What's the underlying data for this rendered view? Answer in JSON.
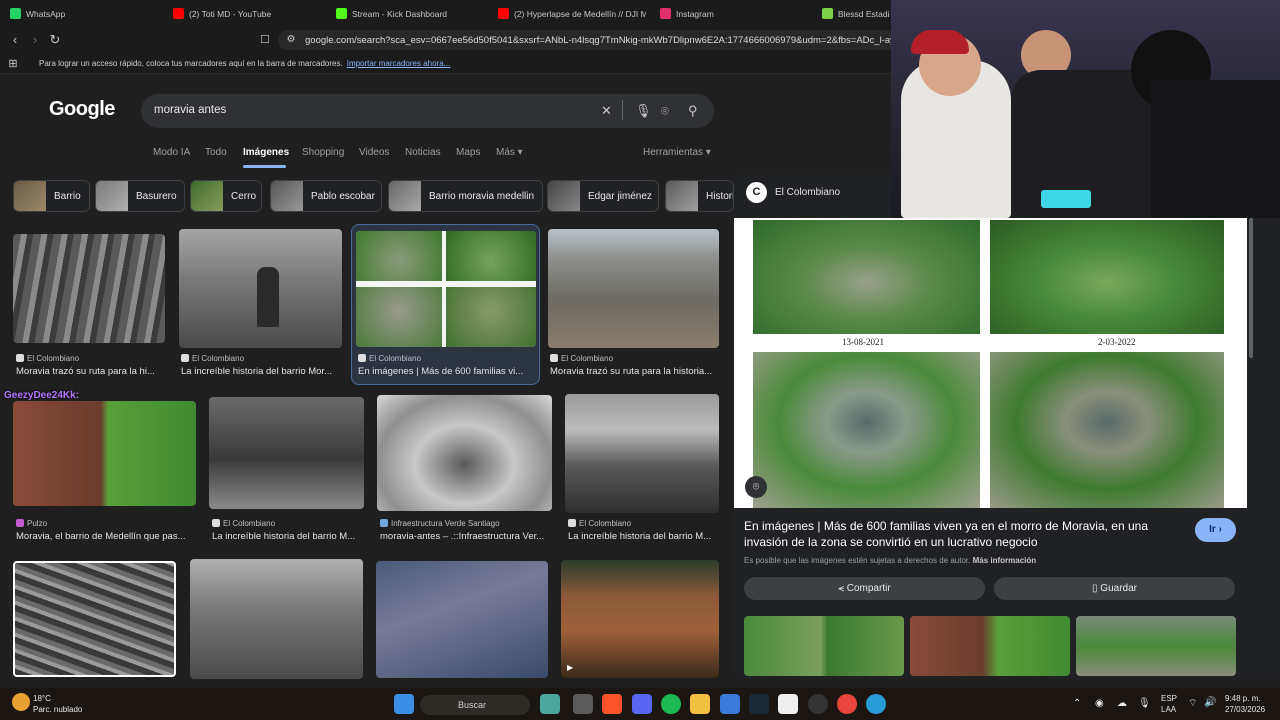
{
  "browser": {
    "tabs": [
      {
        "label": "WhatsApp",
        "color": "#25d366"
      },
      {
        "label": "(2) Toti MD - YouTube",
        "color": "#ff0000"
      },
      {
        "label": "Stream - Kick Dashboard",
        "color": "#53fc18"
      },
      {
        "label": "(2) Hyperlapse de Medellín // DJI M",
        "color": "#ff0000"
      },
      {
        "label": "Instagram",
        "color": "#e1306c"
      },
      {
        "label": "Blessd Estadio",
        "color": "#7cd34a"
      }
    ],
    "url": "google.com/search?sca_esv=0667ee56d50f5041&sxsrf=ANbL-n4lsqg7TmNkig-mkWb7Dlipnw6E2A:1774666006979&udm=2&fbs=ADc_l-ay2rO",
    "bookmarks_text": "Para lograr un acceso rápido, coloca tus marcadores aquí en la barra de marcadores.",
    "bookmarks_link": "Importar marcadores ahora..."
  },
  "google": {
    "logo": "Google",
    "query": "moravia antes",
    "tabs": [
      "Modo IA",
      "Todo",
      "Imágenes",
      "Shopping",
      "Videos",
      "Noticias",
      "Maps",
      "Más ▾"
    ],
    "tools": "Herramientas ▾"
  },
  "chips": [
    "Barrio",
    "Basurero",
    "Cerro",
    "Pablo escobar",
    "Barrio moravia medellin",
    "Edgar jiménez",
    "Histori"
  ],
  "results": [
    {
      "source": "El Colombiano",
      "caption": "Moravia trazó su ruta para la hi..."
    },
    {
      "source": "El Colombiano",
      "caption": "La increíble historia del barrio Mor..."
    },
    {
      "source": "El Colombiano",
      "caption": "En imágenes | Más de 600 familias vi..."
    },
    {
      "source": "El Colombiano",
      "caption": "Moravia trazó su ruta para la historia..."
    },
    {
      "source": "Pulzo",
      "caption": "Moravia, el barrio de Medellín que pas..."
    },
    {
      "source": "El Colombiano",
      "caption": "La increíble historia del barrio M..."
    },
    {
      "source": "Infraestructura Verde Santiago",
      "caption": "moravia-antes – .::Infraestructura Ver..."
    },
    {
      "source": "El Colombiano",
      "caption": "La increíble historia del barrio M..."
    }
  ],
  "overlay_user": "GeezyDee24Kk:",
  "panel": {
    "source": "El Colombiano",
    "date_left": "13-08-2021",
    "date_right": "2-03-2022",
    "title": "En imágenes | Más de 600 familias viven ya en el morro de Moravia, en una invasión de la zona se convirtió en un lucrativo negocio",
    "go": "Ir ›",
    "copyright": "Es posible que las imágenes estén sujetas a derechos de autor.",
    "copyright_link": "Más información",
    "share": "Compartir",
    "save": "Guardar"
  },
  "taskbar": {
    "temp": "18°C",
    "weather": "Parc. nublado",
    "search": "Buscar",
    "lang1": "ESP",
    "lang2": "LAA",
    "time": "9:48 p. m.",
    "date": "27/03/2026"
  }
}
